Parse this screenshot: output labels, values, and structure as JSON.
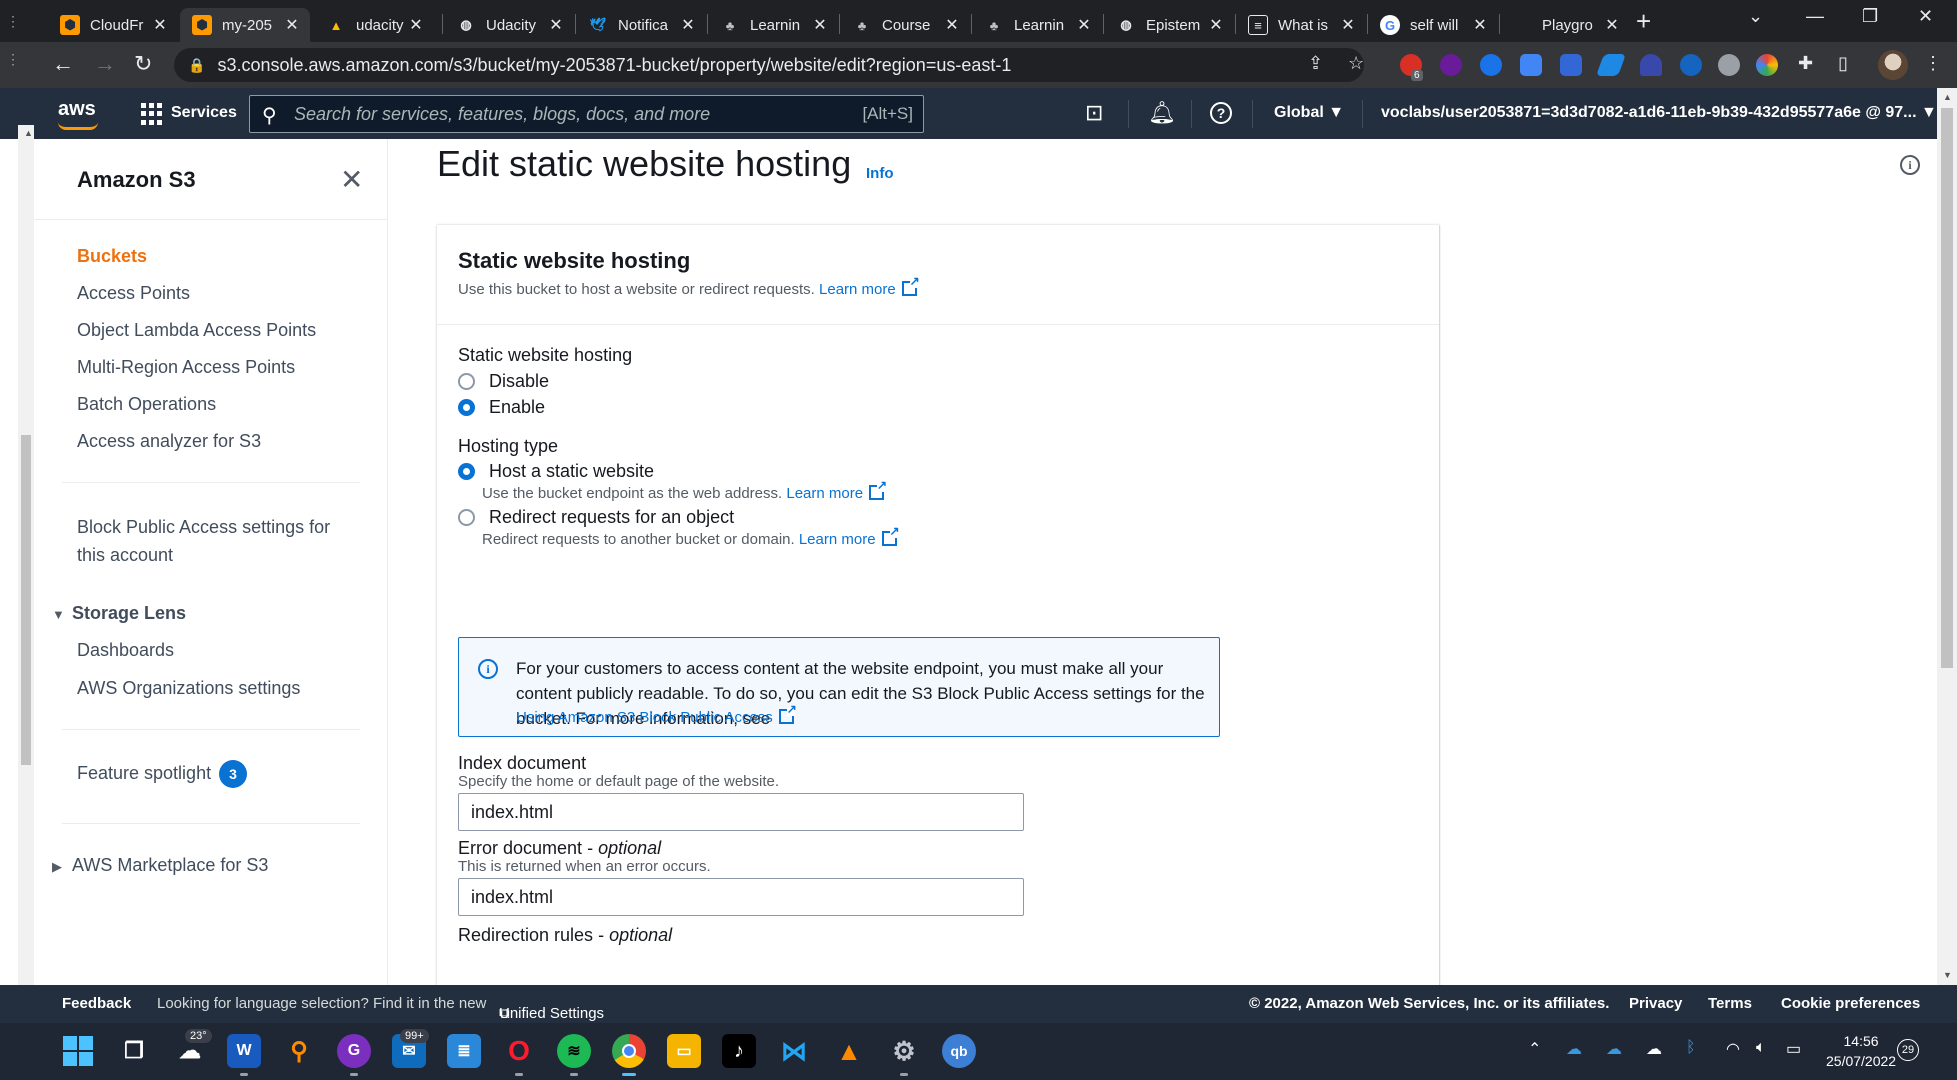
{
  "browser": {
    "tabs": [
      {
        "title": "CloudFr",
        "icon": "aws-box-icon",
        "active": false
      },
      {
        "title": "my-205",
        "icon": "aws-box-icon",
        "active": true
      },
      {
        "title": "udacity",
        "icon": "google-drive-icon",
        "active": false
      },
      {
        "title": "Udacity",
        "icon": "globe-icon",
        "active": false
      },
      {
        "title": "Notifica",
        "icon": "twitter-icon",
        "active": false
      },
      {
        "title": "Learnin",
        "icon": "course-icon",
        "active": false
      },
      {
        "title": "Course",
        "icon": "course-icon",
        "active": false
      },
      {
        "title": "Learnin",
        "icon": "course-icon",
        "active": false
      },
      {
        "title": "Epistem",
        "icon": "globe-icon",
        "active": false
      },
      {
        "title": "What is",
        "icon": "doc-icon",
        "active": false
      },
      {
        "title": "self will",
        "icon": "google-icon",
        "active": false
      },
      {
        "title": "Playgro",
        "icon": "blank-icon",
        "active": false
      }
    ],
    "url": "s3.console.aws.amazon.com/s3/bucket/my-2053871-bucket/property/website/edit?region=us-east-1",
    "extension_badge": "6"
  },
  "aws_header": {
    "logo": "aws",
    "services_label": "Services",
    "search_placeholder": "Search for services, features, blogs, docs, and more",
    "search_shortcut": "[Alt+S]",
    "region": "Global",
    "account": "voclabs/user2053871=3d3d7082-a1d6-11eb-9b39-432d95577a6e @ 97..."
  },
  "sidenav": {
    "title": "Amazon S3",
    "items": [
      "Buckets",
      "Access Points",
      "Object Lambda Access Points",
      "Multi-Region Access Points",
      "Batch Operations",
      "Access analyzer for S3"
    ],
    "block_public_access": [
      "Block Public Access settings for",
      "this account"
    ],
    "storage_lens": {
      "label": "Storage Lens",
      "items": [
        "Dashboards",
        "AWS Organizations settings"
      ]
    },
    "feature_spotlight": {
      "label": "Feature spotlight",
      "count": "3"
    },
    "marketplace": "AWS Marketplace for S3"
  },
  "main": {
    "title": "Edit static website hosting",
    "info": "Info",
    "card": {
      "title": "Static website hosting",
      "description": "Use this bucket to host a website or redirect requests.",
      "learn_more": "Learn more",
      "hosting_label": "Static website hosting",
      "hosting_options": [
        {
          "label": "Disable",
          "selected": false
        },
        {
          "label": "Enable",
          "selected": true
        }
      ],
      "hosting_type_label": "Hosting type",
      "hosting_types": [
        {
          "label": "Host a static website",
          "description": "Use the bucket endpoint as the web address.",
          "selected": true
        },
        {
          "label": "Redirect requests for an object",
          "description": "Redirect requests to another bucket or domain.",
          "selected": false
        }
      ],
      "alert": {
        "text": "For your customers to access content at the website endpoint, you must make all your content publicly readable. To do so, you can edit the S3 Block Public Access settings for the bucket. For more information, see",
        "link": "Using Amazon S3 Block Public Access"
      },
      "index_document": {
        "label": "Index document",
        "description": "Specify the home or default page of the website.",
        "value": "index.html"
      },
      "error_document": {
        "label": "Error document",
        "optional": "optional",
        "description": "This is returned when an error occurs.",
        "value": "index.html"
      },
      "redirection_rules": {
        "label": "Redirection rules",
        "optional": "optional"
      }
    }
  },
  "footer": {
    "feedback": "Feedback",
    "language_note": "Looking for language selection? Find it in the new",
    "unified_settings": "Unified Settings",
    "copyright": "© 2022, Amazon Web Services, Inc. or its affiliates.",
    "privacy": "Privacy",
    "terms": "Terms",
    "cookies": "Cookie preferences"
  },
  "taskbar": {
    "weather": "23°",
    "mail_badge": "99+",
    "time": "14:56",
    "date": "25/07/2022",
    "notifications": "29"
  },
  "colors": {
    "aws_nav": "#232f3e",
    "aws_orange": "#ec7211",
    "link_blue": "#0972d3",
    "chrome_dark": "#202124"
  }
}
